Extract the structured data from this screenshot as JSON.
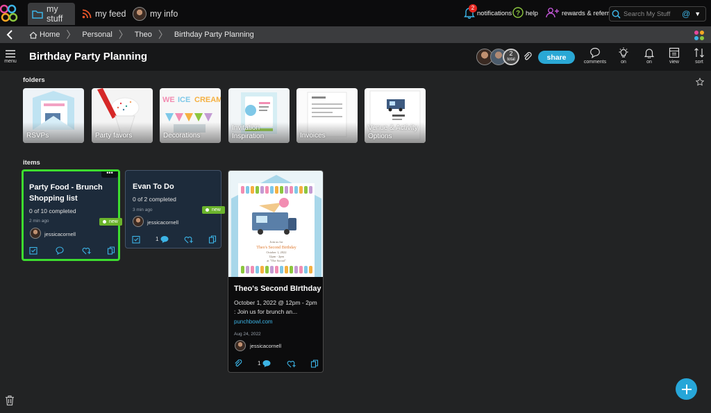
{
  "topbar": {
    "tabs": [
      {
        "label": "my stuff",
        "icon": "folder-icon"
      },
      {
        "label": "my feed",
        "icon": "rss-icon"
      },
      {
        "label": "my info",
        "icon": "avatar"
      }
    ],
    "notifications_label": "notifications",
    "notifications_count": "2",
    "help_label": "help",
    "rewards_label": "rewards & referrals",
    "search_placeholder": "Search My Stuff",
    "search_at": "@"
  },
  "breadcrumb": {
    "home": "Home",
    "items": [
      "Personal",
      "Theo",
      "Birthday Party Planning"
    ]
  },
  "titlebar": {
    "menu_label": "menu",
    "title": "Birthday Party Planning",
    "member_total": "2",
    "member_total_label": "total",
    "share_label": "share",
    "tools": [
      {
        "label": "comments",
        "icon": "comment-icon"
      },
      {
        "label": "on",
        "icon": "lightbulb-icon"
      },
      {
        "label": "on",
        "icon": "bell-icon"
      },
      {
        "label": "view",
        "icon": "view-icon"
      },
      {
        "label": "sort",
        "icon": "sort-icon"
      }
    ]
  },
  "folders_label": "folders",
  "folders": [
    {
      "label": "RSVPs"
    },
    {
      "label": "Party favors"
    },
    {
      "label": "Decorations"
    },
    {
      "label": "Invitation Inspiration"
    },
    {
      "label": "Invoices"
    },
    {
      "label": "Venue & Activity Options"
    }
  ],
  "items_label": "items",
  "items": [
    {
      "title": "Party Food - Brunch Shopping list",
      "progress": "0 of 10 completed",
      "time": "2 min ago",
      "user": "jessicacornell",
      "tag": "new"
    },
    {
      "title": "Evan To Do",
      "progress": "0 of 2 completed",
      "time": "3 min ago",
      "user": "jessicacornell",
      "tag": "new",
      "comment_count": "1"
    }
  ],
  "link_card": {
    "title": "Theo's Second BIrthday",
    "description": "October  1, 2022 @ 12pm - 2pm  : Join us for brunch an...",
    "domain": "punchbowl.com",
    "date": "Aug 24, 2022",
    "user": "jessicacornell",
    "comment_count": "1",
    "invite_lines": [
      "Join us for",
      "Theo's Second Birthday",
      "October 1, 2022",
      "12pm - 2pm",
      "at \"The Social\""
    ]
  },
  "colors": {
    "accent": "#2aa8d5",
    "new_tag": "#6bb42c",
    "selection": "#3ddc2f",
    "card_bg": "#1d2b3b"
  }
}
